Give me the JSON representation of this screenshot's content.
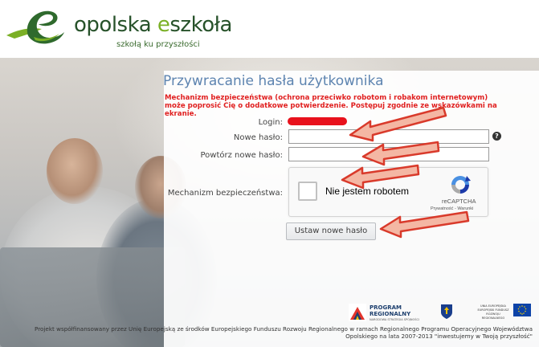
{
  "header": {
    "brand_prefix": "opolska ",
    "brand_accent": "e",
    "brand_suffix": "szkoła",
    "tagline": "szkołą ku przyszłości"
  },
  "form": {
    "title": "Przywracanie hasła użytkownika",
    "warning": "Mechanizm bezpieczeństwa (ochrona przeciwko robotom i robakom internetowym) może poprosić Cię o dodatkowe potwierdzenie. Postępuj zgodnie ze wskazówkami na ekranie.",
    "login_label": "Login:",
    "new_password_label": "Nowe hasło:",
    "repeat_password_label": "Powtórz nowe hasło:",
    "security_label": "Mechanizm bezpieczeństwa:",
    "help_icon_glyph": "?",
    "submit_label": "Ustaw nowe hasło"
  },
  "recaptcha": {
    "checkbox_label": "Nie jestem robotem",
    "brand": "reCAPTCHA",
    "links": "Prywatność - Warunki"
  },
  "footer": {
    "program_line1": "PROGRAM",
    "program_line2": "REGIONALNY",
    "program_sub": "NARODOWA STRATEGIA SPÓJNOŚCI",
    "ue_line1": "UNIA EUROPEJSKA",
    "ue_line2": "EUROPEJSKI FUNDUSZ",
    "ue_line3": "ROZWOJU REGIONALNEGO",
    "text": "Projekt współfinansowany przez Unię Europejską ze środków Europejskiego Funduszu Rozwoju Regionalnego w ramach Regionalnego Programu Operacyjnego Województwa Opolskiego na lata 2007-2013 \"inwestujemy w Twoją przyszłość\""
  },
  "colors": {
    "brand_dark": "#27522a",
    "brand_green": "#7bb026",
    "title_blue": "#5d84b0",
    "warning_red": "#e02020",
    "arrow_red": "#d93a2b",
    "arrow_fill": "#f4b7a4"
  }
}
